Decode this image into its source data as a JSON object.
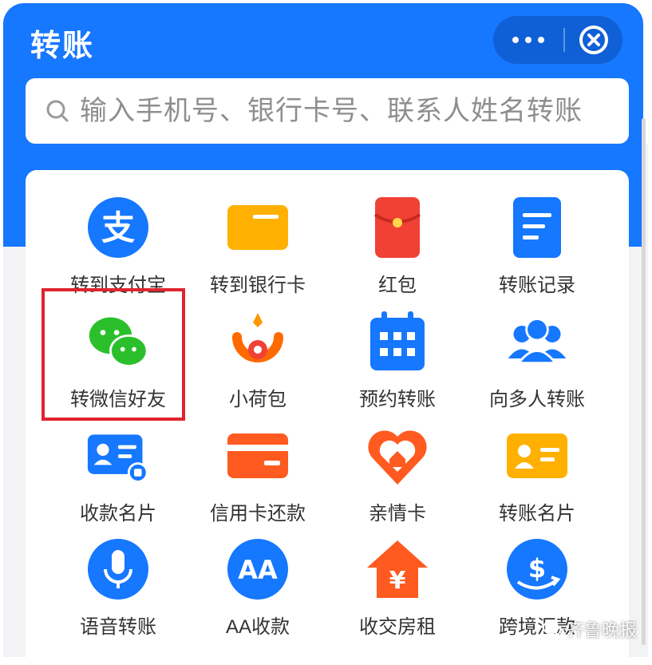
{
  "header": {
    "title": "转账"
  },
  "capsule": {
    "more_icon": "more-dots-icon",
    "close_icon": "close-circle-icon"
  },
  "search": {
    "placeholder": "输入手机号、银行卡号、联系人姓名转账",
    "icon": "search-icon"
  },
  "grid": {
    "items": [
      {
        "label": "转到支付宝",
        "icon": "alipay-icon",
        "color": "#1677ff"
      },
      {
        "label": "转到银行卡",
        "icon": "bank-card-icon",
        "color": "#ffb000"
      },
      {
        "label": "红包",
        "icon": "red-envelope-icon",
        "color": "#f04134"
      },
      {
        "label": "转账记录",
        "icon": "record-document-icon",
        "color": "#1677ff"
      },
      {
        "label": "转微信好友",
        "icon": "wechat-icon",
        "color": "#2bc02b"
      },
      {
        "label": "小荷包",
        "icon": "purse-icon",
        "color": "#ff6a00"
      },
      {
        "label": "预约转账",
        "icon": "calendar-icon",
        "color": "#1677ff"
      },
      {
        "label": "向多人转账",
        "icon": "group-users-icon",
        "color": "#1677ff"
      },
      {
        "label": "收款名片",
        "icon": "contact-card-icon",
        "color": "#1677ff"
      },
      {
        "label": "信用卡还款",
        "icon": "credit-card-icon",
        "color": "#ff5a1f"
      },
      {
        "label": "亲情卡",
        "icon": "family-heart-icon",
        "color": "#ff5a1f"
      },
      {
        "label": "转账名片",
        "icon": "name-card-icon",
        "color": "#ffb000"
      },
      {
        "label": "语音转账",
        "icon": "microphone-icon",
        "color": "#1677ff"
      },
      {
        "label": "AA收款",
        "icon": "aa-icon",
        "color": "#1677ff"
      },
      {
        "label": "收交房租",
        "icon": "house-rent-icon",
        "color": "#ff5a1f"
      },
      {
        "label": "跨境汇款",
        "icon": "cross-border-dollar-icon",
        "color": "#1677ff"
      }
    ]
  },
  "watermark": {
    "text": "齐鲁晚报",
    "icon": "wechat-logo-icon"
  }
}
